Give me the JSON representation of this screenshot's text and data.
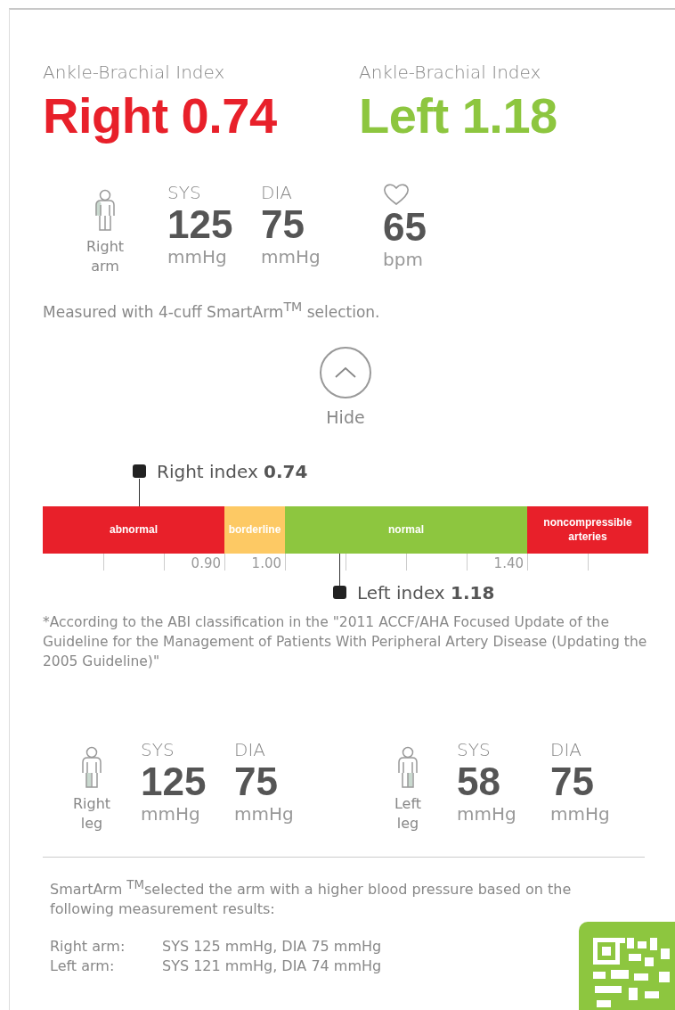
{
  "abi": [
    {
      "label": "Ankle-Brachial Index",
      "value": "Right 0.74",
      "color": "#e8202a"
    },
    {
      "label": "Ankle-Brachial Index",
      "value": "Left 1.18",
      "color": "#8dc63f"
    }
  ],
  "arm": {
    "kind": "right-arm",
    "label": "Right arm",
    "sys_label": "SYS",
    "sys": "125",
    "sys_unit": "mmHg",
    "dia_label": "DIA",
    "dia": "75",
    "dia_unit": "mmHg",
    "pulse": "65",
    "pulse_unit": "bpm"
  },
  "note": "Measured with 4-cuff SmartArm$^{TM}$ selection.",
  "toggle": {
    "label": "Hide"
  },
  "scale": {
    "segments": [
      {
        "label": "abnormal",
        "color": "#e8202a"
      },
      {
        "label": "borderline",
        "color": "#fdc964"
      },
      {
        "label": "normal",
        "color": "#8dc63f"
      },
      {
        "label": "noncompressible arteries",
        "color": "#e8202a"
      }
    ],
    "tick_labels": [
      "0.90",
      "1.00",
      "1.40"
    ],
    "markers": [
      {
        "text": "Right index **0.74**",
        "kind": "above"
      },
      {
        "text": "Left index **1.18**",
        "kind": "below"
      }
    ]
  },
  "footnote": "*According to the ABI classification in the \"2011 ACCF/AHA Focused Update of the Guideline for the Management of Patients With Peripheral Artery Disease (Updating the 2005 Guideline)\"",
  "legs": [
    {
      "kind": "right-leg",
      "label": "Right leg",
      "sys_label": "SYS",
      "sys": "125",
      "sys_unit": "mmHg",
      "dia_label": "DIA",
      "dia": "75",
      "dia_unit": "mmHg"
    },
    {
      "kind": "left-leg",
      "label": "Left leg",
      "sys_label": "SYS",
      "sys": "58",
      "sys_unit": "mmHg",
      "dia_label": "DIA",
      "dia": "75",
      "dia_unit": "mmHg"
    }
  ],
  "smartarm_text": "SmartArm $^{TM}$selected the arm with a higher blood pressure based on the following measurement results:",
  "results": [
    {
      "label": "Right arm:",
      "value": "SYS 125 mmHg, DIA 75 mmHg"
    },
    {
      "label": "Left arm:",
      "value": "SYS 121 mmHg, DIA 74 mmHg"
    }
  ]
}
